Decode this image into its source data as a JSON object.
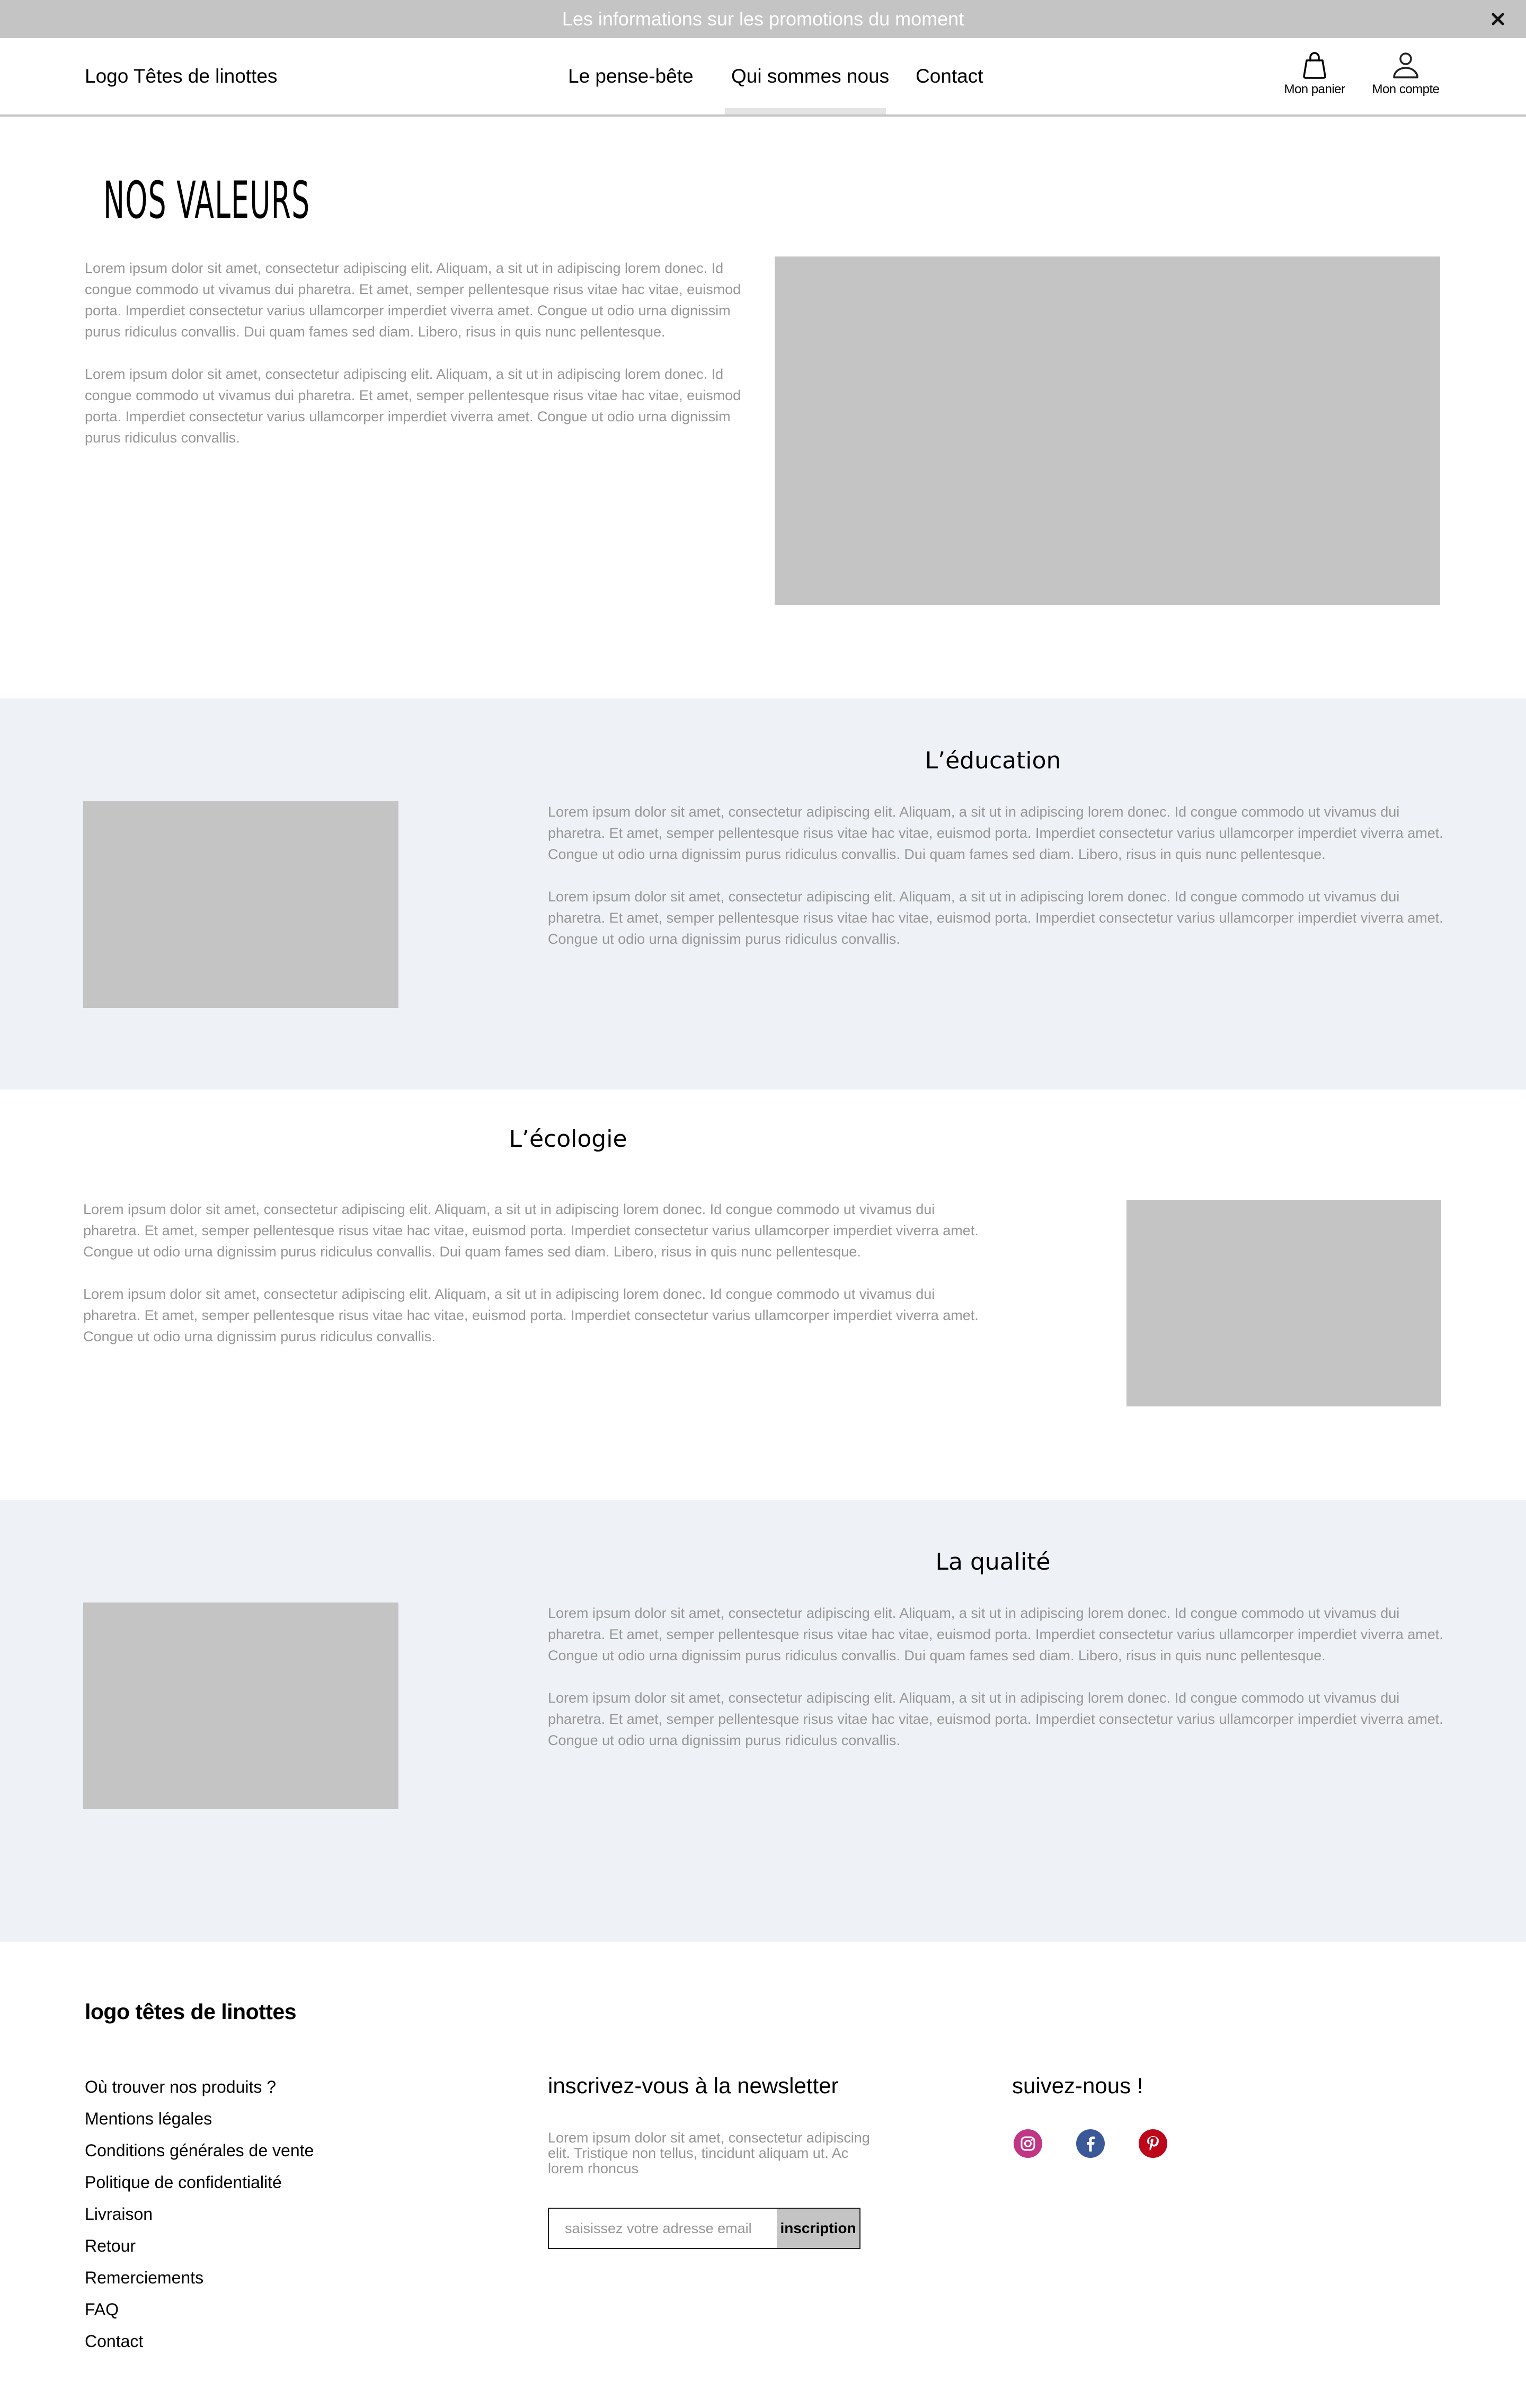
{
  "promo": {
    "text": "Les informations sur les promotions du moment",
    "close_icon": "close-icon"
  },
  "header": {
    "logo": "Logo Têtes de linottes",
    "nav": [
      {
        "label": "Le pense-bête",
        "active": false
      },
      {
        "label": "Qui sommes nous",
        "active": true
      },
      {
        "label": "Contact",
        "active": false
      }
    ],
    "cart": {
      "label": "Mon panier",
      "icon": "shopping-bag-icon"
    },
    "account": {
      "label": "Mon compte",
      "icon": "user-icon"
    }
  },
  "intro": {
    "title": "NOS VALEURS",
    "paragraphs": [
      "Lorem ipsum dolor sit amet, consectetur adipiscing elit. Aliquam, a sit ut in adipiscing lorem donec. Id congue commodo ut vivamus dui pharetra. Et amet, semper pellentesque risus vitae hac vitae, euismod porta. Imperdiet consectetur varius ullamcorper imperdiet viverra amet. Congue ut odio urna dignissim purus ridiculus convallis. Dui quam fames sed diam. Libero, risus in quis nunc pellentesque.",
      "Lorem ipsum dolor sit amet, consectetur adipiscing elit. Aliquam, a sit ut in adipiscing lorem donec. Id congue commodo ut vivamus dui pharetra. Et amet, semper pellentesque risus vitae hac vitae, euismod porta. Imperdiet consectetur varius ullamcorper imperdiet viverra amet. Congue ut odio urna dignissim purus ridiculus convallis."
    ]
  },
  "sections": [
    {
      "title": "L’éducation",
      "paragraphs": [
        "Lorem ipsum dolor sit amet, consectetur adipiscing elit. Aliquam, a sit ut in adipiscing lorem donec. Id congue commodo ut vivamus dui pharetra. Et amet, semper pellentesque risus vitae hac vitae, euismod porta. Imperdiet consectetur varius ullamcorper imperdiet viverra amet. Congue ut odio urna dignissim purus ridiculus convallis. Dui quam fames sed diam. Libero, risus in quis nunc pellentesque.",
        "Lorem ipsum dolor sit amet, consectetur adipiscing elit. Aliquam, a sit ut in adipiscing lorem donec. Id congue commodo ut vivamus dui pharetra. Et amet, semper pellentesque risus vitae hac vitae, euismod porta. Imperdiet consectetur varius ullamcorper imperdiet viverra amet. Congue ut odio urna dignissim purus ridiculus convallis."
      ]
    },
    {
      "title": "L’écologie",
      "paragraphs": [
        "Lorem ipsum dolor sit amet, consectetur adipiscing elit. Aliquam, a sit ut in adipiscing lorem donec. Id congue commodo ut vivamus dui pharetra. Et amet, semper pellentesque risus vitae hac vitae, euismod porta. Imperdiet consectetur varius ullamcorper imperdiet viverra amet. Congue ut odio urna dignissim purus ridiculus convallis. Dui quam fames sed diam. Libero, risus in quis nunc pellentesque.",
        "Lorem ipsum dolor sit amet, consectetur adipiscing elit. Aliquam, a sit ut in adipiscing lorem donec. Id congue commodo ut vivamus dui pharetra. Et amet, semper pellentesque risus vitae hac vitae, euismod porta. Imperdiet consectetur varius ullamcorper imperdiet viverra amet. Congue ut odio urna dignissim purus ridiculus convallis."
      ]
    },
    {
      "title": "La qualité",
      "paragraphs": [
        "Lorem ipsum dolor sit amet, consectetur adipiscing elit. Aliquam, a sit ut in adipiscing lorem donec. Id congue commodo ut vivamus dui pharetra. Et amet, semper pellentesque risus vitae hac vitae, euismod porta. Imperdiet consectetur varius ullamcorper imperdiet viverra amet. Congue ut odio urna dignissim purus ridiculus convallis. Dui quam fames sed diam. Libero, risus in quis nunc pellentesque.",
        "Lorem ipsum dolor sit amet, consectetur adipiscing elit. Aliquam, a sit ut in adipiscing lorem donec. Id congue commodo ut vivamus dui pharetra. Et amet, semper pellentesque risus vitae hac vitae, euismod porta. Imperdiet consectetur varius ullamcorper imperdiet viverra amet. Congue ut odio urna dignissim purus ridiculus convallis."
      ]
    }
  ],
  "footer": {
    "logo": "logo têtes de linottes",
    "links": [
      "Où trouver nos produits ?",
      "Mentions légales",
      "Conditions générales de vente",
      "Politique de confidentialité",
      "Livraison",
      "Retour",
      "Remerciements",
      "FAQ",
      "Contact"
    ],
    "newsletter": {
      "title": "inscrivez-vous à la newsletter",
      "description": "Lorem ipsum dolor sit amet, consectetur adipiscing elit. Tristique non tellus, tincidunt aliquam ut. Ac lorem rhoncus",
      "placeholder": "saisissez votre adresse email",
      "value": "",
      "button": "inscription"
    },
    "social": {
      "title": "suivez-nous !",
      "networks": [
        {
          "name": "Instagram",
          "icon": "instagram-icon",
          "color": "#c13584"
        },
        {
          "name": "Facebook",
          "icon": "facebook-icon",
          "color": "#3b5998"
        },
        {
          "name": "Pinterest",
          "icon": "pinterest-icon",
          "color": "#bd081c"
        }
      ]
    }
  },
  "colors": {
    "promo_bg": "#c4c4c4",
    "band_bg": "#eef1f6",
    "placeholder_image": "#c4c4c4",
    "body_text": "#969696",
    "nav_active_indicator": "#e4e4e4"
  }
}
